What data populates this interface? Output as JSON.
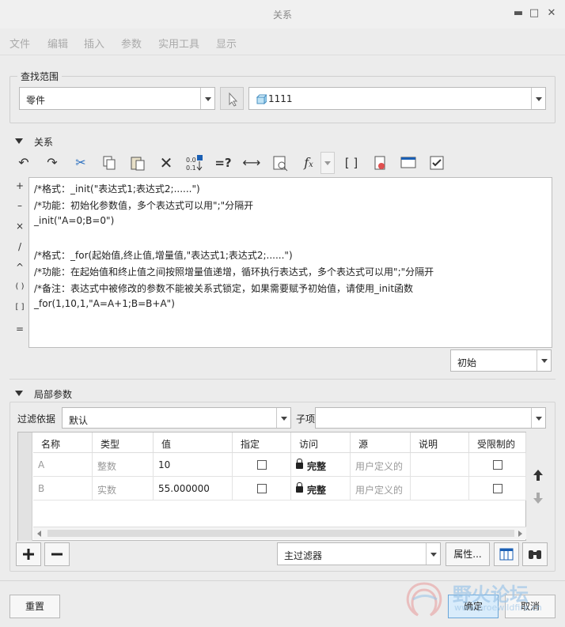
{
  "window": {
    "title": "关系"
  },
  "menu": [
    "文件",
    "编辑",
    "插入",
    "参数",
    "实用工具",
    "显示"
  ],
  "lookup": {
    "legend": "查找范围",
    "scope_value": "零件",
    "model_value": "1111"
  },
  "relations": {
    "header": "关系",
    "side_ops": [
      "+",
      "–",
      "×",
      "/",
      "^",
      "( )",
      "[ ]",
      "="
    ],
    "lines": [
      "/*格式：_init(\"表达式1;表达式2;......\")",
      "/*功能：初始化参数值，多个表达式可以用\";\"分隔开",
      "_init(\"A=0;B=0\")",
      "",
      "/*格式：_for(起始值,终止值,增量值,\"表达式1;表达式2;......\")",
      "/*功能：在起始值和终止值之间按照增量值递增，循环执行表达式，多个表达式可以用\";\"分隔开",
      "/*备注：表达式中被修改的参数不能被关系式锁定，如果需要赋予初始值，请使用_init函数",
      "_for(1,10,1,\"A=A+1;B=B+A\")"
    ],
    "state_value": "初始",
    "toolbar_extra": "=?"
  },
  "local_params": {
    "header": "局部参数",
    "filter_label": "过滤依据",
    "filter_value": "默认",
    "subitem_label": "子项",
    "columns": [
      "名称",
      "类型",
      "值",
      "指定",
      "访问",
      "源",
      "说明",
      "受限制的"
    ],
    "rows": [
      {
        "name": "A",
        "type": "整数",
        "value": "10",
        "access": "完整",
        "source": "用户定义的"
      },
      {
        "name": "B",
        "type": "实数",
        "value": "55.000000",
        "access": "完整",
        "source": "用户定义的"
      }
    ],
    "main_filter": "主过滤器",
    "properties_button": "属性..."
  },
  "footer": {
    "reset": "重置",
    "ok": "确定",
    "cancel": "取消"
  },
  "watermark": {
    "text": "野火论坛",
    "url": "www.proewildfire.cn"
  }
}
